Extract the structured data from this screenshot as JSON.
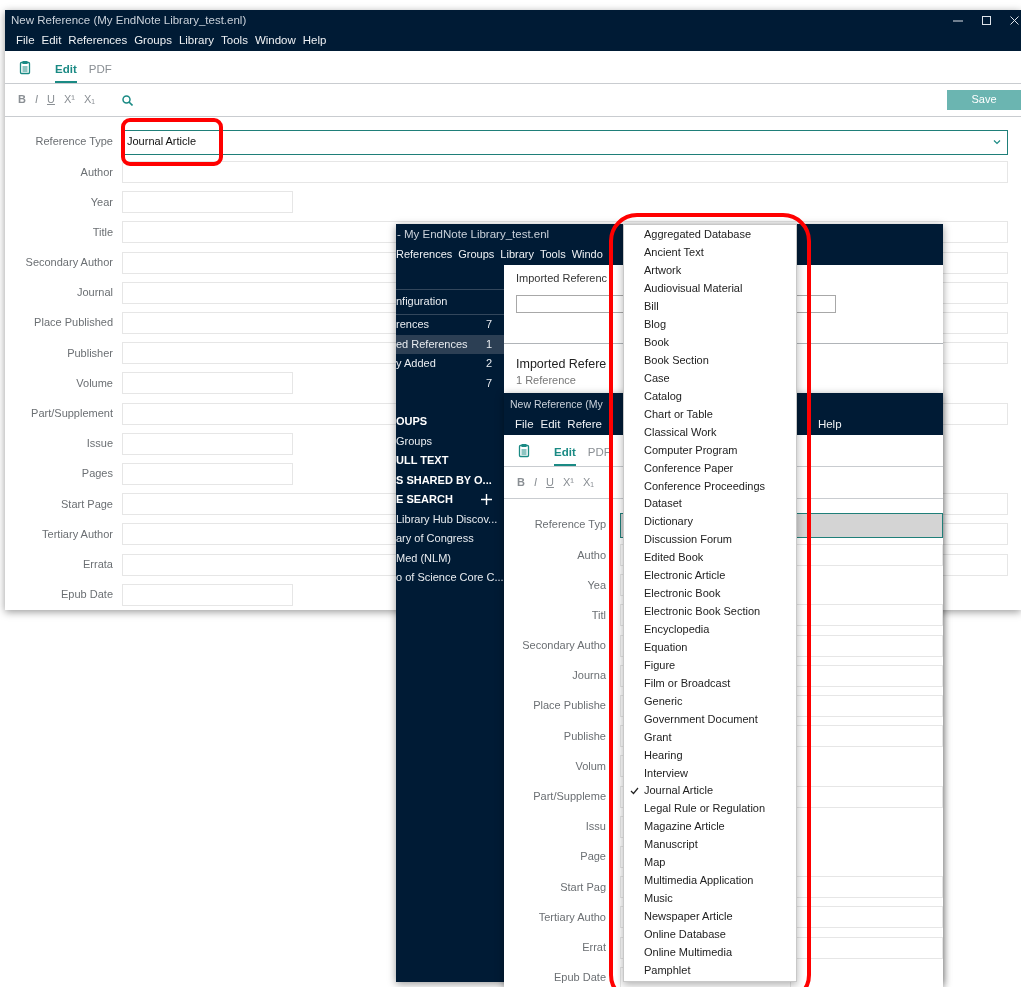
{
  "main_window": {
    "title": "New Reference (My EndNote Library_test.enl)",
    "menu": [
      "File",
      "Edit",
      "References",
      "Groups",
      "Library",
      "Tools",
      "Window",
      "Help"
    ],
    "tabs": [
      {
        "label": "Edit",
        "selected": true
      },
      {
        "label": "PDF",
        "selected": false
      }
    ],
    "format_buttons": [
      {
        "label": "B",
        "kind": "bold"
      },
      {
        "label": "I",
        "kind": "italic"
      },
      {
        "label": "U",
        "kind": "underline"
      },
      {
        "label": "X¹",
        "kind": "plain"
      },
      {
        "label": "X₁",
        "kind": "plain"
      }
    ],
    "save_button": "Save",
    "reference_type": {
      "label": "Reference Type",
      "value": "Journal Article"
    },
    "fields": [
      {
        "label": "Author",
        "kind": "long"
      },
      {
        "label": "Year",
        "kind": "short"
      },
      {
        "label": "Title",
        "kind": "long"
      },
      {
        "label": "Secondary Author",
        "kind": "long"
      },
      {
        "label": "Journal",
        "kind": "long"
      },
      {
        "label": "Place Published",
        "kind": "long"
      },
      {
        "label": "Publisher",
        "kind": "long"
      },
      {
        "label": "Volume",
        "kind": "short"
      },
      {
        "label": "Part/Supplement",
        "kind": "long"
      },
      {
        "label": "Issue",
        "kind": "short"
      },
      {
        "label": "Pages",
        "kind": "short"
      },
      {
        "label": "Start Page",
        "kind": "long"
      },
      {
        "label": "Tertiary Author",
        "kind": "long"
      },
      {
        "label": "Errata",
        "kind": "long"
      },
      {
        "label": "Epub Date",
        "kind": "short"
      }
    ]
  },
  "library_window": {
    "title": "- My EndNote Library_test.enl",
    "menu": [
      "References",
      "Groups",
      "Library",
      "Tools",
      "Windo"
    ],
    "sidebar": [
      {
        "label": "nfiguration",
        "kind": "config",
        "selected": false
      },
      {
        "label": "rences",
        "count": "7",
        "kind": "item",
        "selected": false
      },
      {
        "label": "ed References",
        "count": "1",
        "kind": "item",
        "selected": true
      },
      {
        "label": "y Added",
        "count": "2",
        "kind": "item",
        "selected": false
      },
      {
        "count": "7",
        "kind": "item",
        "selected": false
      },
      {
        "label": "OUPS",
        "kind": "header",
        "selected": false
      },
      {
        "label": "Groups",
        "kind": "item",
        "selected": false
      },
      {
        "label": "ULL TEXT",
        "kind": "header",
        "selected": false
      },
      {
        "label": "S SHARED BY O...",
        "kind": "header",
        "selected": false
      },
      {
        "label": "E SEARCH",
        "kind": "header_add",
        "selected": false
      },
      {
        "label": "Library Hub Discov...",
        "kind": "item",
        "selected": false
      },
      {
        "label": "ary of Congress",
        "kind": "item",
        "selected": false
      },
      {
        "label": "Med (NLM)",
        "kind": "item",
        "selected": false
      },
      {
        "label": "o of Science Core C...",
        "kind": "item",
        "selected": false
      }
    ],
    "tab_label": "Imported Referenc",
    "heading": "Imported Refere",
    "reference_count": "1 Reference"
  },
  "nested_window": {
    "title": "New Reference (My",
    "menu": [
      "File",
      "Edit",
      "Refere",
      "Help"
    ],
    "tabs": [
      {
        "label": "Edit",
        "selected": true
      },
      {
        "label": "PDF",
        "selected": false
      }
    ],
    "format_buttons": [
      {
        "label": "B",
        "kind": "bold"
      },
      {
        "label": "I",
        "kind": "italic"
      },
      {
        "label": "U",
        "kind": "underline"
      },
      {
        "label": "X¹",
        "kind": "plain"
      },
      {
        "label": "X₁",
        "kind": "plain"
      }
    ],
    "reference_type": {
      "label": "Reference Typ"
    },
    "fields": [
      {
        "label": "Autho",
        "kind": "long"
      },
      {
        "label": "Yea",
        "kind": "short"
      },
      {
        "label": "Titl",
        "kind": "long"
      },
      {
        "label": "Secondary Autho",
        "kind": "long"
      },
      {
        "label": "Journa",
        "kind": "long"
      },
      {
        "label": "Place Publishe",
        "kind": "long"
      },
      {
        "label": "Publishe",
        "kind": "long"
      },
      {
        "label": "Volum",
        "kind": "short"
      },
      {
        "label": "Part/Suppleme",
        "kind": "long"
      },
      {
        "label": "Issu",
        "kind": "short"
      },
      {
        "label": "Page",
        "kind": "short"
      },
      {
        "label": "Start Pag",
        "kind": "long"
      },
      {
        "label": "Tertiary Autho",
        "kind": "long"
      },
      {
        "label": "Errat",
        "kind": "long"
      },
      {
        "label": "Epub Date",
        "kind": "short"
      }
    ]
  },
  "dropdown": {
    "items": [
      {
        "label": "Aggregated Database",
        "selected": false
      },
      {
        "label": "Ancient Text",
        "selected": false
      },
      {
        "label": "Artwork",
        "selected": false
      },
      {
        "label": "Audiovisual Material",
        "selected": false
      },
      {
        "label": "Bill",
        "selected": false
      },
      {
        "label": "Blog",
        "selected": false
      },
      {
        "label": "Book",
        "selected": false
      },
      {
        "label": "Book Section",
        "selected": false
      },
      {
        "label": "Case",
        "selected": false
      },
      {
        "label": "Catalog",
        "selected": false
      },
      {
        "label": "Chart or Table",
        "selected": false
      },
      {
        "label": "Classical Work",
        "selected": false
      },
      {
        "label": "Computer Program",
        "selected": false
      },
      {
        "label": "Conference Paper",
        "selected": false
      },
      {
        "label": "Conference Proceedings",
        "selected": false
      },
      {
        "label": "Dataset",
        "selected": false
      },
      {
        "label": "Dictionary",
        "selected": false
      },
      {
        "label": "Discussion Forum",
        "selected": false
      },
      {
        "label": "Edited Book",
        "selected": false
      },
      {
        "label": "Electronic Article",
        "selected": false
      },
      {
        "label": "Electronic Book",
        "selected": false
      },
      {
        "label": "Electronic Book Section",
        "selected": false
      },
      {
        "label": "Encyclopedia",
        "selected": false
      },
      {
        "label": "Equation",
        "selected": false
      },
      {
        "label": "Figure",
        "selected": false
      },
      {
        "label": "Film or Broadcast",
        "selected": false
      },
      {
        "label": "Generic",
        "selected": false
      },
      {
        "label": "Government Document",
        "selected": false
      },
      {
        "label": "Grant",
        "selected": false
      },
      {
        "label": "Hearing",
        "selected": false
      },
      {
        "label": "Interview",
        "selected": false
      },
      {
        "label": "Journal Article",
        "selected": true
      },
      {
        "label": "Legal Rule or Regulation",
        "selected": false
      },
      {
        "label": "Magazine Article",
        "selected": false
      },
      {
        "label": "Manuscript",
        "selected": false
      },
      {
        "label": "Map",
        "selected": false
      },
      {
        "label": "Multimedia Application",
        "selected": false
      },
      {
        "label": "Music",
        "selected": false
      },
      {
        "label": "Newspaper Article",
        "selected": false
      },
      {
        "label": "Online Database",
        "selected": false
      },
      {
        "label": "Online Multimedia",
        "selected": false
      },
      {
        "label": "Pamphlet",
        "selected": false
      }
    ]
  }
}
